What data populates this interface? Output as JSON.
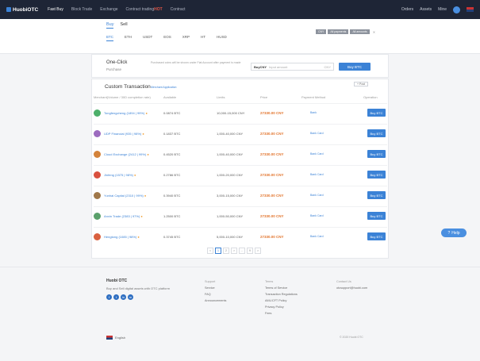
{
  "nav": {
    "logo": "HuobiOTC",
    "links": [
      {
        "label": "Fast Buy",
        "active": true
      },
      {
        "label": "Block Trade",
        "active": false
      },
      {
        "label": "Exchange",
        "active": false
      },
      {
        "label": "Contract trading",
        "hot": "HOT",
        "active": false
      },
      {
        "label": "Contract",
        "active": false
      }
    ],
    "right": [
      "Orders",
      "Assets",
      "Mine"
    ]
  },
  "hero": {
    "tabs": [
      {
        "label": "Buy",
        "active": true
      },
      {
        "label": "Sell",
        "active": false
      }
    ],
    "coins": [
      {
        "label": "BTC",
        "active": true
      },
      {
        "label": "ETH",
        "active": false
      },
      {
        "label": "USDT",
        "active": false
      },
      {
        "label": "EOS",
        "active": false
      },
      {
        "label": "XRP",
        "active": false
      },
      {
        "label": "HT",
        "active": false
      },
      {
        "label": "HUSD",
        "active": false
      }
    ],
    "filters": [
      "CNY",
      "All payments",
      "All amounts"
    ]
  },
  "oneclick": {
    "title": "One-Click",
    "subtitle": "Purchase",
    "description": "Purchased coins will be shown under Fiat Account after payment is made",
    "currency": "BuyCNY",
    "placeholder": "Input amount",
    "unit": "CNY",
    "button": "Buy BTC"
  },
  "table": {
    "title": "Custom Transaction",
    "link": "Merchant Application",
    "post_button": "+ Post",
    "headers": [
      "Merchant(Volume / 30D completion rate)",
      "Available",
      "Limits",
      "Price",
      "Payment Method",
      "Operation"
    ],
    "rows": [
      {
        "name": "Tongfengcheng (1894 | 99%)",
        "available": "0.0874 BTC",
        "limits": "10,000-15,000 CNY",
        "price": "27330.00 CNY",
        "payment": "Bank",
        "button": "Buy BTC",
        "color": "#4caf6a"
      },
      {
        "name": "UDP Financial (935 | 98%)",
        "available": "0.1837 BTC",
        "limits": "1,000-40,000 CNY",
        "price": "27330.00 CNY",
        "payment": "Bank Card",
        "button": "Buy BTC",
        "color": "#9c6bbf"
      },
      {
        "name": "Cloud Exchange (2412 | 99%)",
        "available": "0.4520 BTC",
        "limits": "1,000-40,000 CNY",
        "price": "27330.00 CNY",
        "payment": "Bank Card",
        "button": "Buy BTC",
        "color": "#d4833b"
      },
      {
        "name": "Jinfeng (1575 | 98%)",
        "available": "0.2786 BTC",
        "limits": "1,000-20,000 CNY",
        "price": "27330.00 CNY",
        "payment": "Bank Card",
        "button": "Buy BTC",
        "color": "#d9503f"
      },
      {
        "name": "Yunhai Capital (2310 | 99%)",
        "available": "0.3940 BTC",
        "limits": "3,000-15,000 CNY",
        "price": "27330.00 CNY",
        "payment": "Bank Card",
        "button": "Buy BTC",
        "color": "#a0784a"
      },
      {
        "name": "Anxin Trade (2383 | 97%)",
        "available": "1.2500 BTC",
        "limits": "1,000-50,000 CNY",
        "price": "27330.00 CNY",
        "payment": "Bank Card",
        "button": "Buy BTC",
        "color": "#5aa06b"
      },
      {
        "name": "Hengtong (1085 | 98%)",
        "available": "0.3745 BTC",
        "limits": "5,000-10,000 CNY",
        "price": "27330.00 CNY",
        "payment": "Bank Card",
        "button": "Buy BTC",
        "color": "#d9603f"
      }
    ],
    "pager": [
      "<",
      "1",
      "2",
      ">",
      "...",
      "9",
      ">"
    ]
  },
  "help": "Help",
  "footer": {
    "brand": "Huobi OTC",
    "slogan": "Buy and Sell digital assets with OTC platform",
    "social": [
      "f",
      "t",
      "in",
      "m"
    ],
    "col1": {
      "heading": "Support",
      "items": [
        "Service",
        "FAQ",
        "Announcements"
      ]
    },
    "col2": {
      "heading": "Terms",
      "items": [
        "Terms of Service",
        "Transaction Regulations",
        "AML/CFT Policy",
        "Privacy Policy",
        "Fees"
      ]
    },
    "col3": {
      "heading": "Contact Us",
      "items": [
        "otcsupport@huobi.com"
      ]
    },
    "lang": "English",
    "copyright": "© 2020 Huobi OTC"
  }
}
